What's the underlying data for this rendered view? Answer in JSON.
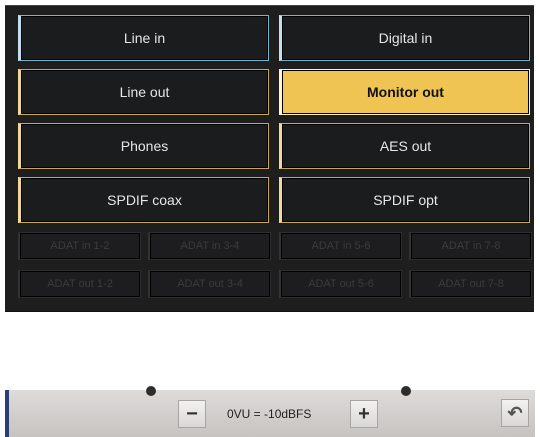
{
  "routing": {
    "main_buttons": [
      {
        "label": "Line in",
        "style": "blue"
      },
      {
        "label": "Digital in",
        "style": "blue"
      },
      {
        "label": "Line out",
        "style": "gold"
      },
      {
        "label": "Monitor out",
        "style": "active"
      },
      {
        "label": "Phones",
        "style": "gold"
      },
      {
        "label": "AES out",
        "style": "gold"
      },
      {
        "label": "SPDIF coax",
        "style": "gold"
      },
      {
        "label": "SPDIF opt",
        "style": "gold"
      }
    ],
    "adat_in": [
      "ADAT in 1-2",
      "ADAT in 3-4",
      "ADAT in 5-6",
      "ADAT in 7-8"
    ],
    "adat_out": [
      "ADAT out 1-2",
      "ADAT out 3-4",
      "ADAT out 5-6",
      "ADAT out 7-8"
    ]
  },
  "level_bar": {
    "decrease_symbol": "−",
    "increase_symbol": "+",
    "label": "0VU = -10dBFS",
    "back_symbol": "↶"
  }
}
